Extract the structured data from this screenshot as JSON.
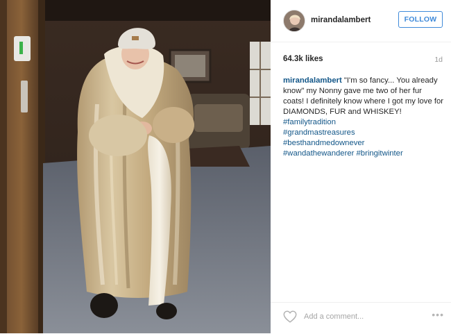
{
  "post": {
    "username": "mirandalambert",
    "follow_label": "FOLLOW",
    "likes": "64.3k likes",
    "time_ago": "1d",
    "caption_text": "\"I'm so fancy... You already know\" my Nonny gave me two of her fur coats! I definitely know where I got my love for DIAMONDS, FUR and WHISKEY!",
    "hashtags": [
      "#familytradition",
      "#grandmastreasures",
      "#besthandmedownever",
      "#wandathewanderer",
      "#bringitwinter"
    ],
    "comment_placeholder": "Add a comment...",
    "more_label": "•••"
  },
  "colors": {
    "link": "#125688",
    "follow": "#3f8ad9"
  },
  "icons": {
    "like": "heart-outline-icon",
    "more": "more-options-icon"
  }
}
